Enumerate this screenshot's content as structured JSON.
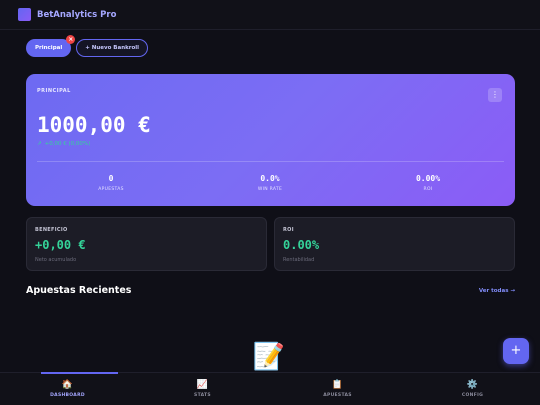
{
  "app": {
    "title": "BetAnalytics Pro"
  },
  "tabs": {
    "main_label": "Principal",
    "badge": "×",
    "new_label": "+ Nuevo Bankroll"
  },
  "hero": {
    "label": "PRINCIPAL",
    "menu_icon": "⋮",
    "balance": "1000,00 €",
    "delta": "+0,00 € (0,00%)",
    "stats": [
      {
        "value": "0",
        "label": "APUESTAS"
      },
      {
        "value": "0.0%",
        "label": "WIN RATE"
      },
      {
        "value": "0.00%",
        "label": "ROI"
      }
    ]
  },
  "cards": {
    "profit": {
      "label": "BENEFICIO",
      "value": "+0,00 €",
      "sub": "Neto acumulado"
    },
    "roi": {
      "label": "ROI",
      "value": "0.00%",
      "sub": "Rentabilidad"
    }
  },
  "recent": {
    "title": "Apuestas Recientes",
    "see_all": "Ver todas →",
    "empty_icon": "📝"
  },
  "fab": {
    "label": "+"
  },
  "nav": [
    {
      "icon": "🏠",
      "label": "DASHBOARD"
    },
    {
      "icon": "📈",
      "label": "STATS"
    },
    {
      "icon": "📋",
      "label": "APUESTAS"
    },
    {
      "icon": "⚙️",
      "label": "CONFIG"
    }
  ],
  "colors": {
    "accent": "#6366f1",
    "positive": "#34d399",
    "background": "#0f0f17"
  }
}
